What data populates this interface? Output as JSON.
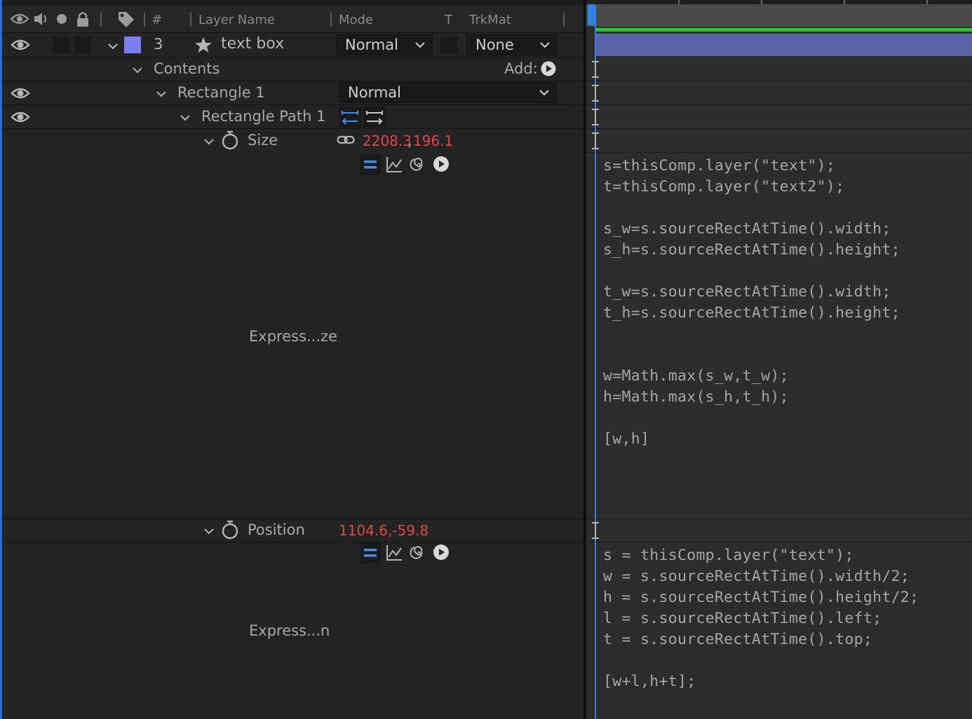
{
  "header": {
    "col_hash": "#",
    "col_layer_name": "Layer Name",
    "col_mode": "Mode",
    "col_t": "T",
    "col_trkmat": "TrkMat"
  },
  "layer": {
    "number": "3",
    "name": "text box",
    "mode": "Normal",
    "trkmat": "None",
    "label_color": "#7b7ef0"
  },
  "contents": {
    "label": "Contents",
    "add_label": "Add:"
  },
  "rectangle": {
    "label": "Rectangle 1",
    "mode": "Normal"
  },
  "rect_path": {
    "label": "Rectangle Path 1"
  },
  "size": {
    "label": "Size",
    "value_w": "2208.3",
    "sep": ",",
    "value_h": "196.1",
    "expression_label": "Express...ze",
    "code": "s=thisComp.layer(\"text\");\nt=thisComp.layer(\"text2\");\n\ns_w=s.sourceRectAtTime().width;\ns_h=s.sourceRectAtTime().height;\n\nt_w=s.sourceRectAtTime().width;\nt_h=s.sourceRectAtTime().height;\n\n\nw=Math.max(s_w,t_w);\nh=Math.max(s_h,t_h);\n\n[w,h]"
  },
  "position": {
    "label": "Position",
    "value": "1104.6,-59.8",
    "expression_label": "Express...n",
    "code": "s = thisComp.layer(\"text\");\nw = s.sourceRectAtTime().width/2;\nh = s.sourceRectAtTime().height/2;\nl = s.sourceRectAtTime().left;\nt = s.sourceRectAtTime().top;\n\n[w+l,h+t];"
  },
  "colors": {
    "value_red": "#e04646",
    "accent_blue": "#2f82e6",
    "layer_bar": "#5a63a8",
    "work_area_green": "#2fc62f"
  }
}
